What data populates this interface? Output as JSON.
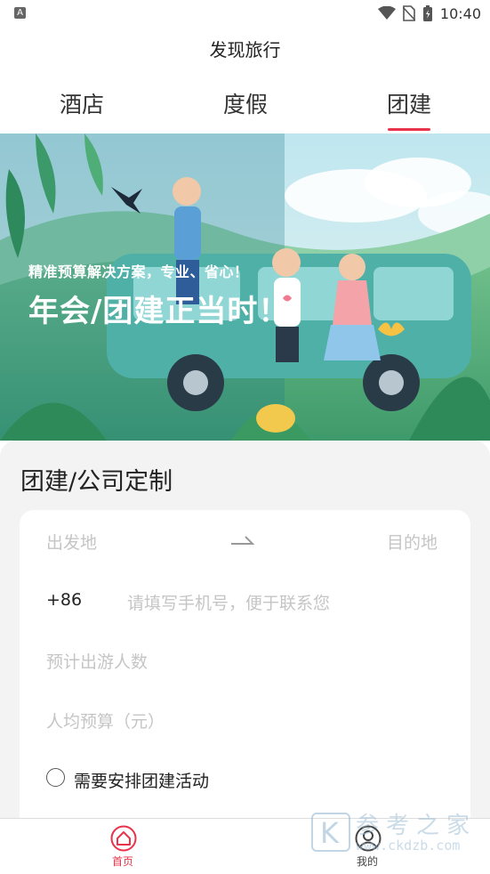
{
  "status_bar": {
    "notification_icon": "A",
    "time": "10:40",
    "icons": [
      "wifi-icon",
      "no-sim-icon",
      "battery-charging-icon"
    ]
  },
  "header": {
    "title": "发现旅行"
  },
  "tabs": [
    {
      "label": "酒店",
      "selected": false
    },
    {
      "label": "度假",
      "selected": false
    },
    {
      "label": "团建",
      "selected": true
    }
  ],
  "banner": {
    "subtitle": "精准预算解决方案，专业、省心！",
    "headline": "年会/团建正当时！"
  },
  "card": {
    "title": "团建/公司定制",
    "form": {
      "origin_placeholder": "出发地",
      "destination_placeholder": "目的地",
      "phone_prefix": "+86",
      "phone_placeholder": "请填写手机号，便于联系您",
      "people_placeholder": "预计出游人数",
      "budget_placeholder": "人均预算（元）",
      "activity_checkbox_label": "需要安排团建活动",
      "activity_checked": false
    }
  },
  "bottom_nav": [
    {
      "label": "首页",
      "icon": "home-icon",
      "active": true
    },
    {
      "label": "我的",
      "icon": "profile-icon",
      "active": false
    }
  ],
  "watermark": {
    "mark": "K",
    "text": "参考之家",
    "url": "www.ckdzb.com"
  },
  "colors": {
    "accent": "#e8334a",
    "placeholder": "#c5c5c5",
    "card_bg": "#f3f3f3"
  }
}
